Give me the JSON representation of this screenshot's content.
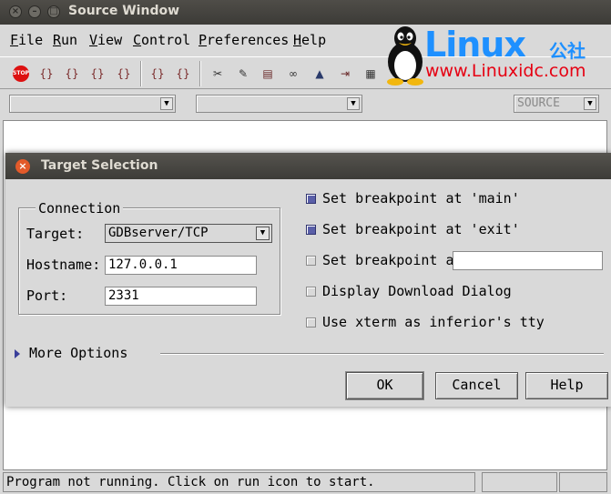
{
  "window": {
    "title": "Source Window"
  },
  "menu": [
    {
      "label": "File",
      "key": "F",
      "rest": "ile"
    },
    {
      "label": "Run",
      "key": "R",
      "rest": "un"
    },
    {
      "label": "View",
      "key": "V",
      "rest": "iew"
    },
    {
      "label": "Control",
      "key": "C",
      "rest": "ontrol"
    },
    {
      "label": "Preferences",
      "key": "P",
      "rest": "references"
    },
    {
      "label": "Help",
      "key": "H",
      "rest": "elp"
    }
  ],
  "toolbar": {
    "stop_label": "STOP",
    "icons": [
      "stop-icon",
      "step-icon",
      "next-icon",
      "finish-icon",
      "continue-icon",
      "stepi-icon",
      "nexti-icon",
      "up-icon",
      "down-icon",
      "bottom-icon",
      "registers-icon",
      "memory-icon",
      "stack-icon",
      "watch-icon"
    ]
  },
  "source_combo": {
    "value": "SOURCE"
  },
  "watermark": {
    "brand": "Linux",
    "brand_cn": "公社",
    "url": "www.Linuxidc.com"
  },
  "status": {
    "text": "Program not running. Click on run icon to start."
  },
  "dialog": {
    "title": "Target Selection",
    "connection": {
      "legend": "Connection",
      "target_label": "Target:",
      "target_value": "GDBserver/TCP",
      "hostname_label": "Hostname:",
      "hostname_value": "127.0.0.1",
      "port_label": "Port:",
      "port_value": "2331"
    },
    "options": [
      {
        "label": "Set breakpoint at 'main'",
        "checked": true
      },
      {
        "label": "Set breakpoint at 'exit'",
        "checked": true
      },
      {
        "label": "Set breakpoint at",
        "checked": false
      },
      {
        "label": "Display Download Dialog",
        "checked": false
      },
      {
        "label": "Use xterm as inferior's tty",
        "checked": false
      }
    ],
    "more_options": "More Options",
    "buttons": {
      "ok": "OK",
      "cancel": "Cancel",
      "help": "Help"
    }
  }
}
